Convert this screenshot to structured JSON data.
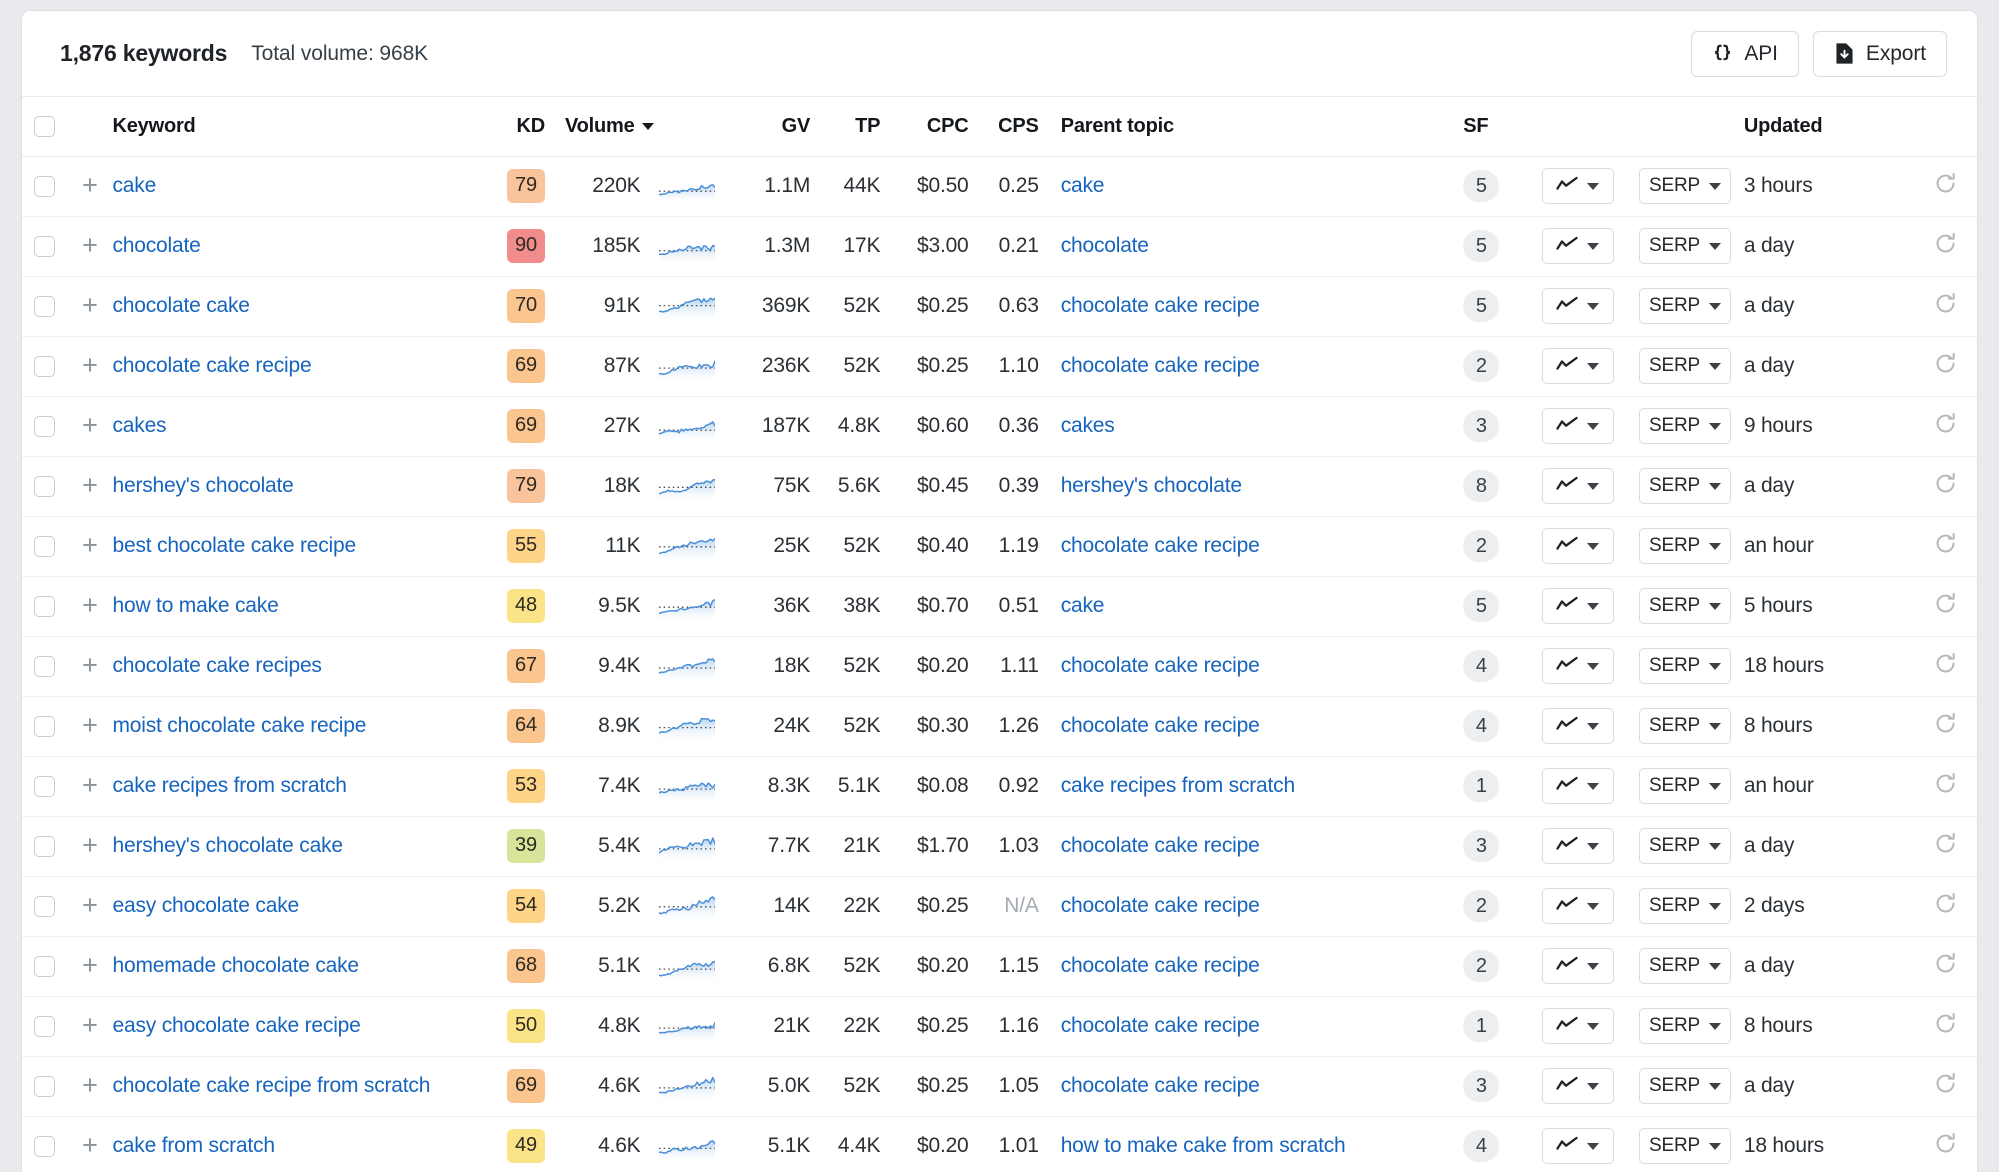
{
  "toolbar": {
    "keyword_count": "1,876 keywords",
    "total_volume": "Total volume: 968K",
    "api_label": "API",
    "api_icon": "braces-icon",
    "export_label": "Export",
    "export_icon": "file-download-icon"
  },
  "table": {
    "columns": {
      "keyword": "Keyword",
      "kd": "KD",
      "volume": "Volume",
      "volume_sort": "desc",
      "gv": "GV",
      "tp": "TP",
      "cpc": "CPC",
      "cps": "CPS",
      "parent_topic": "Parent topic",
      "sf": "SF",
      "updated": "Updated"
    },
    "row_controls": {
      "position_icon": "trend-line-icon",
      "serp_label": "SERP",
      "refresh_icon": "refresh-icon",
      "expand_icon": "plus-icon",
      "select_icon": "checkbox-icon"
    },
    "rows": [
      {
        "keyword": "cake",
        "kd": "79",
        "kd_color": "#f9c49b",
        "volume": "220K",
        "gv": "1.1M",
        "tp": "44K",
        "cpc": "$0.50",
        "cps": "0.25",
        "parent_topic": "cake",
        "sf": "5",
        "updated": "3 hours"
      },
      {
        "keyword": "chocolate",
        "kd": "90",
        "kd_color": "#f28c8c",
        "volume": "185K",
        "gv": "1.3M",
        "tp": "17K",
        "cpc": "$3.00",
        "cps": "0.21",
        "parent_topic": "chocolate",
        "sf": "5",
        "updated": "a day"
      },
      {
        "keyword": "chocolate cake",
        "kd": "70",
        "kd_color": "#fbc590",
        "volume": "91K",
        "gv": "369K",
        "tp": "52K",
        "cpc": "$0.25",
        "cps": "0.63",
        "parent_topic": "chocolate cake recipe",
        "sf": "5",
        "updated": "a day"
      },
      {
        "keyword": "chocolate cake recipe",
        "kd": "69",
        "kd_color": "#fbc590",
        "volume": "87K",
        "gv": "236K",
        "tp": "52K",
        "cpc": "$0.25",
        "cps": "1.10",
        "parent_topic": "chocolate cake recipe",
        "sf": "2",
        "updated": "a day"
      },
      {
        "keyword": "cakes",
        "kd": "69",
        "kd_color": "#fbc590",
        "volume": "27K",
        "gv": "187K",
        "tp": "4.8K",
        "cpc": "$0.60",
        "cps": "0.36",
        "parent_topic": "cakes",
        "sf": "3",
        "updated": "9 hours"
      },
      {
        "keyword": "hershey's chocolate",
        "kd": "79",
        "kd_color": "#f9c49b",
        "volume": "18K",
        "gv": "75K",
        "tp": "5.6K",
        "cpc": "$0.45",
        "cps": "0.39",
        "parent_topic": "hershey's chocolate",
        "sf": "8",
        "updated": "a day"
      },
      {
        "keyword": "best chocolate cake recipe",
        "kd": "55",
        "kd_color": "#fdd488",
        "volume": "11K",
        "gv": "25K",
        "tp": "52K",
        "cpc": "$0.40",
        "cps": "1.19",
        "parent_topic": "chocolate cake recipe",
        "sf": "2",
        "updated": "an hour"
      },
      {
        "keyword": "how to make cake",
        "kd": "48",
        "kd_color": "#fbe487",
        "volume": "9.5K",
        "gv": "36K",
        "tp": "38K",
        "cpc": "$0.70",
        "cps": "0.51",
        "parent_topic": "cake",
        "sf": "5",
        "updated": "5 hours"
      },
      {
        "keyword": "chocolate cake recipes",
        "kd": "67",
        "kd_color": "#fbc590",
        "volume": "9.4K",
        "gv": "18K",
        "tp": "52K",
        "cpc": "$0.20",
        "cps": "1.11",
        "parent_topic": "chocolate cake recipe",
        "sf": "4",
        "updated": "18 hours"
      },
      {
        "keyword": "moist chocolate cake recipe",
        "kd": "64",
        "kd_color": "#fbc590",
        "volume": "8.9K",
        "gv": "24K",
        "tp": "52K",
        "cpc": "$0.30",
        "cps": "1.26",
        "parent_topic": "chocolate cake recipe",
        "sf": "4",
        "updated": "8 hours"
      },
      {
        "keyword": "cake recipes from scratch",
        "kd": "53",
        "kd_color": "#fdd488",
        "volume": "7.4K",
        "gv": "8.3K",
        "tp": "5.1K",
        "cpc": "$0.08",
        "cps": "0.92",
        "parent_topic": "cake recipes from scratch",
        "sf": "1",
        "updated": "an hour"
      },
      {
        "keyword": "hershey's chocolate cake",
        "kd": "39",
        "kd_color": "#d8e49a",
        "volume": "5.4K",
        "gv": "7.7K",
        "tp": "21K",
        "cpc": "$1.70",
        "cps": "1.03",
        "parent_topic": "chocolate cake recipe",
        "sf": "3",
        "updated": "a day"
      },
      {
        "keyword": "easy chocolate cake",
        "kd": "54",
        "kd_color": "#fdd488",
        "volume": "5.2K",
        "gv": "14K",
        "tp": "22K",
        "cpc": "$0.25",
        "cps": "N/A",
        "parent_topic": "chocolate cake recipe",
        "sf": "2",
        "updated": "2 days"
      },
      {
        "keyword": "homemade chocolate cake",
        "kd": "68",
        "kd_color": "#fbc590",
        "volume": "5.1K",
        "gv": "6.8K",
        "tp": "52K",
        "cpc": "$0.20",
        "cps": "1.15",
        "parent_topic": "chocolate cake recipe",
        "sf": "2",
        "updated": "a day"
      },
      {
        "keyword": "easy chocolate cake recipe",
        "kd": "50",
        "kd_color": "#fbe487",
        "volume": "4.8K",
        "gv": "21K",
        "tp": "22K",
        "cpc": "$0.25",
        "cps": "1.16",
        "parent_topic": "chocolate cake recipe",
        "sf": "1",
        "updated": "8 hours"
      },
      {
        "keyword": "chocolate cake recipe from scratch",
        "kd": "69",
        "kd_color": "#fbc590",
        "volume": "4.6K",
        "gv": "5.0K",
        "tp": "52K",
        "cpc": "$0.25",
        "cps": "1.05",
        "parent_topic": "chocolate cake recipe",
        "sf": "3",
        "updated": "a day"
      },
      {
        "keyword": "cake from scratch",
        "kd": "49",
        "kd_color": "#fbe487",
        "volume": "4.6K",
        "gv": "5.1K",
        "tp": "4.4K",
        "cpc": "$0.20",
        "cps": "1.01",
        "parent_topic": "how to make cake from scratch",
        "sf": "4",
        "updated": "18 hours"
      }
    ]
  },
  "colors": {
    "link": "#1664c0",
    "spark_line": "#4a90d9",
    "panel_bg": "#ffffff",
    "page_bg": "#e8eaed"
  }
}
